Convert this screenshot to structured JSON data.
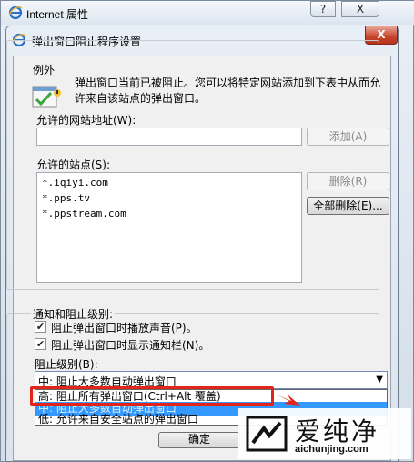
{
  "outer_window": {
    "title": "Internet 属性",
    "help_label": "?",
    "close_label": "X"
  },
  "dialog": {
    "title": "弹出窗口阻止程序设置",
    "close_label": "X",
    "exceptions": {
      "legend": "例外",
      "description_line1": "弹出窗口当前已被阻止。您可以将特定网站添加到下表中从而允",
      "description_line2": "许来自该站点的弹出窗口。",
      "address_label": "允许的网站地址(W):",
      "address_value": "",
      "add_button": "添加(A)",
      "allowed_sites_label": "允许的站点(S):",
      "allowed_sites": [
        "*.iqiyi.com",
        "*.pps.tv",
        "*.ppstream.com"
      ],
      "remove_button": "删除(R)",
      "remove_all_button": "全部删除(E)..."
    },
    "notifications": {
      "legend": "通知和阻止级别:",
      "play_sound": {
        "label": "阻止弹出窗口时播放声音(P)。",
        "checked": true
      },
      "show_bar": {
        "label": "阻止弹出窗口时显示通知栏(N)。",
        "checked": true
      },
      "blocking_level_label": "阻止级别(B):",
      "selected_level": "中: 阻止大多数自动弹出窗口",
      "options": [
        "高: 阻止所有弹出窗口(Ctrl+Alt 覆盖)",
        "中: 阻止大多数自动弹出窗口",
        "低: 允许来自安全站点的弹出窗口"
      ]
    },
    "ok_button": "确定"
  },
  "watermark": {
    "title": "爱纯净",
    "url": "aichunjing.com"
  },
  "colors": {
    "highlight": "#e2241a",
    "selection": "#3399ff",
    "close_button": "#c7442c"
  }
}
